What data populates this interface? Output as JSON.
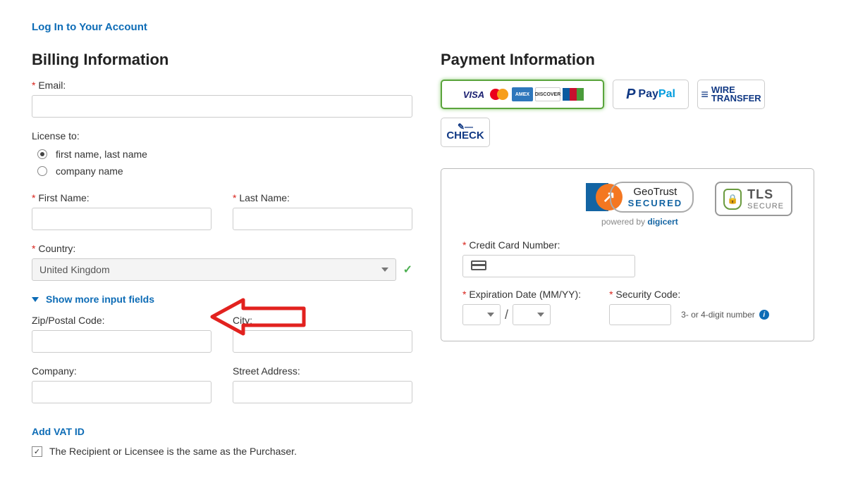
{
  "login_link": "Log In to Your Account",
  "billing": {
    "heading": "Billing Information",
    "email_label": "Email:",
    "license_to_label": "License to:",
    "license_opt_person": "first name, last name",
    "license_opt_company": "company name",
    "first_name_label": "First Name:",
    "last_name_label": "Last Name:",
    "country_label": "Country:",
    "country_value": "United Kingdom",
    "show_more": "Show more input fields",
    "zip_label": "Zip/Postal Code:",
    "city_label": "City:",
    "company_label": "Company:",
    "street_label": "Street Address:",
    "vat_link": "Add VAT ID",
    "same_as_purchaser": "The Recipient or Licensee is the same as the Purchaser."
  },
  "payment": {
    "heading": "Payment Information",
    "options": {
      "cards": "VISA / Mastercard / AMEX / Discover / JCB",
      "paypal": "PayPal",
      "wire_line1": "WIRE",
      "wire_line2": "TRANSFER",
      "check": "CHECK"
    },
    "trust": {
      "geo_line1": "GeoTrust",
      "geo_line2": "SECURED",
      "digicert_prefix": "powered by ",
      "digicert_brand": "digicert",
      "tls_line1": "TLS",
      "tls_line2": "SECURE"
    },
    "cc_number_label": "Credit Card Number:",
    "exp_label": "Expiration Date (MM/YY):",
    "sec_label": "Security Code:",
    "sec_hint": "3- or 4-digit number"
  }
}
